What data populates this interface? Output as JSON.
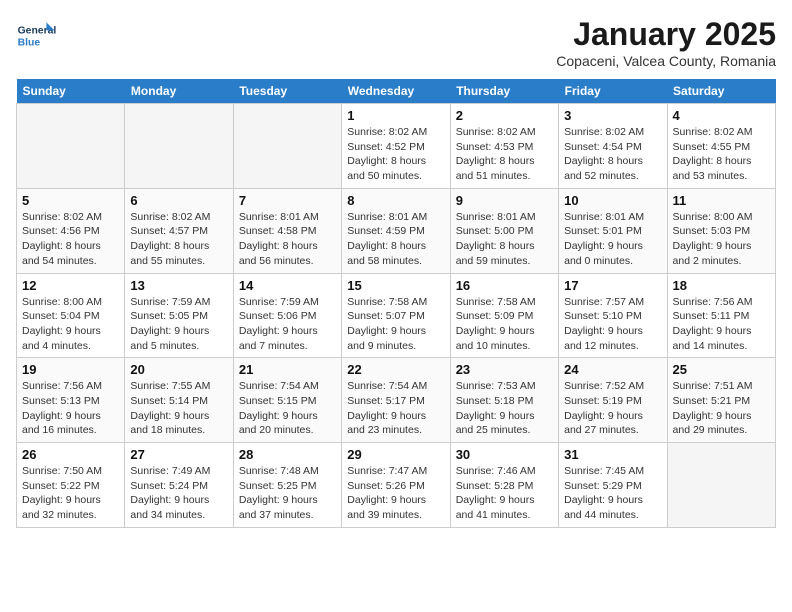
{
  "logo": {
    "general": "General",
    "blue": "Blue"
  },
  "title": "January 2025",
  "location": "Copaceni, Valcea County, Romania",
  "weekdays": [
    "Sunday",
    "Monday",
    "Tuesday",
    "Wednesday",
    "Thursday",
    "Friday",
    "Saturday"
  ],
  "weeks": [
    [
      {
        "day": "",
        "info": ""
      },
      {
        "day": "",
        "info": ""
      },
      {
        "day": "",
        "info": ""
      },
      {
        "day": "1",
        "info": "Sunrise: 8:02 AM\nSunset: 4:52 PM\nDaylight: 8 hours\nand 50 minutes."
      },
      {
        "day": "2",
        "info": "Sunrise: 8:02 AM\nSunset: 4:53 PM\nDaylight: 8 hours\nand 51 minutes."
      },
      {
        "day": "3",
        "info": "Sunrise: 8:02 AM\nSunset: 4:54 PM\nDaylight: 8 hours\nand 52 minutes."
      },
      {
        "day": "4",
        "info": "Sunrise: 8:02 AM\nSunset: 4:55 PM\nDaylight: 8 hours\nand 53 minutes."
      }
    ],
    [
      {
        "day": "5",
        "info": "Sunrise: 8:02 AM\nSunset: 4:56 PM\nDaylight: 8 hours\nand 54 minutes."
      },
      {
        "day": "6",
        "info": "Sunrise: 8:02 AM\nSunset: 4:57 PM\nDaylight: 8 hours\nand 55 minutes."
      },
      {
        "day": "7",
        "info": "Sunrise: 8:01 AM\nSunset: 4:58 PM\nDaylight: 8 hours\nand 56 minutes."
      },
      {
        "day": "8",
        "info": "Sunrise: 8:01 AM\nSunset: 4:59 PM\nDaylight: 8 hours\nand 58 minutes."
      },
      {
        "day": "9",
        "info": "Sunrise: 8:01 AM\nSunset: 5:00 PM\nDaylight: 8 hours\nand 59 minutes."
      },
      {
        "day": "10",
        "info": "Sunrise: 8:01 AM\nSunset: 5:01 PM\nDaylight: 9 hours\nand 0 minutes."
      },
      {
        "day": "11",
        "info": "Sunrise: 8:00 AM\nSunset: 5:03 PM\nDaylight: 9 hours\nand 2 minutes."
      }
    ],
    [
      {
        "day": "12",
        "info": "Sunrise: 8:00 AM\nSunset: 5:04 PM\nDaylight: 9 hours\nand 4 minutes."
      },
      {
        "day": "13",
        "info": "Sunrise: 7:59 AM\nSunset: 5:05 PM\nDaylight: 9 hours\nand 5 minutes."
      },
      {
        "day": "14",
        "info": "Sunrise: 7:59 AM\nSunset: 5:06 PM\nDaylight: 9 hours\nand 7 minutes."
      },
      {
        "day": "15",
        "info": "Sunrise: 7:58 AM\nSunset: 5:07 PM\nDaylight: 9 hours\nand 9 minutes."
      },
      {
        "day": "16",
        "info": "Sunrise: 7:58 AM\nSunset: 5:09 PM\nDaylight: 9 hours\nand 10 minutes."
      },
      {
        "day": "17",
        "info": "Sunrise: 7:57 AM\nSunset: 5:10 PM\nDaylight: 9 hours\nand 12 minutes."
      },
      {
        "day": "18",
        "info": "Sunrise: 7:56 AM\nSunset: 5:11 PM\nDaylight: 9 hours\nand 14 minutes."
      }
    ],
    [
      {
        "day": "19",
        "info": "Sunrise: 7:56 AM\nSunset: 5:13 PM\nDaylight: 9 hours\nand 16 minutes."
      },
      {
        "day": "20",
        "info": "Sunrise: 7:55 AM\nSunset: 5:14 PM\nDaylight: 9 hours\nand 18 minutes."
      },
      {
        "day": "21",
        "info": "Sunrise: 7:54 AM\nSunset: 5:15 PM\nDaylight: 9 hours\nand 20 minutes."
      },
      {
        "day": "22",
        "info": "Sunrise: 7:54 AM\nSunset: 5:17 PM\nDaylight: 9 hours\nand 23 minutes."
      },
      {
        "day": "23",
        "info": "Sunrise: 7:53 AM\nSunset: 5:18 PM\nDaylight: 9 hours\nand 25 minutes."
      },
      {
        "day": "24",
        "info": "Sunrise: 7:52 AM\nSunset: 5:19 PM\nDaylight: 9 hours\nand 27 minutes."
      },
      {
        "day": "25",
        "info": "Sunrise: 7:51 AM\nSunset: 5:21 PM\nDaylight: 9 hours\nand 29 minutes."
      }
    ],
    [
      {
        "day": "26",
        "info": "Sunrise: 7:50 AM\nSunset: 5:22 PM\nDaylight: 9 hours\nand 32 minutes."
      },
      {
        "day": "27",
        "info": "Sunrise: 7:49 AM\nSunset: 5:24 PM\nDaylight: 9 hours\nand 34 minutes."
      },
      {
        "day": "28",
        "info": "Sunrise: 7:48 AM\nSunset: 5:25 PM\nDaylight: 9 hours\nand 37 minutes."
      },
      {
        "day": "29",
        "info": "Sunrise: 7:47 AM\nSunset: 5:26 PM\nDaylight: 9 hours\nand 39 minutes."
      },
      {
        "day": "30",
        "info": "Sunrise: 7:46 AM\nSunset: 5:28 PM\nDaylight: 9 hours\nand 41 minutes."
      },
      {
        "day": "31",
        "info": "Sunrise: 7:45 AM\nSunset: 5:29 PM\nDaylight: 9 hours\nand 44 minutes."
      },
      {
        "day": "",
        "info": ""
      }
    ]
  ]
}
